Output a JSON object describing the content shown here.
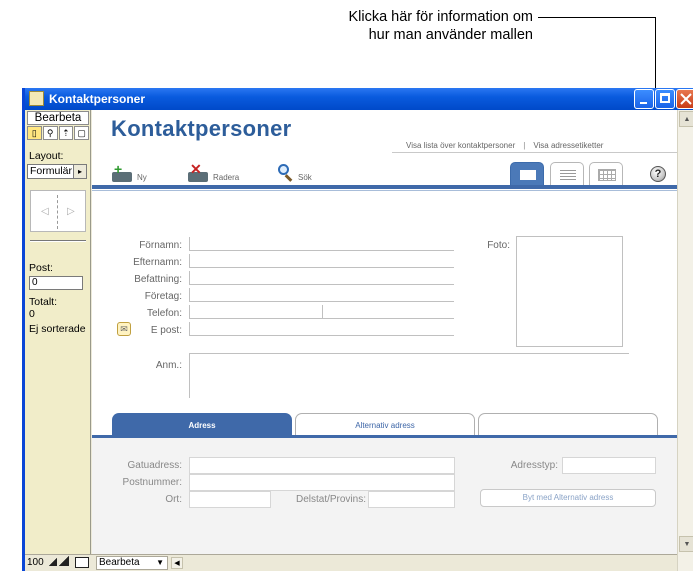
{
  "callout": {
    "line1": "Klicka här för information om",
    "line2": "hur man använder mallen"
  },
  "window": {
    "title": "Kontaktpersoner"
  },
  "toolbox": {
    "mode": "Bearbeta",
    "layout_label": "Layout:",
    "layout_value": "Formulär",
    "post_label": "Post:",
    "post_value": "0",
    "total_label": "Totalt:",
    "total_value": "0",
    "sort_status": "Ej sorterade"
  },
  "content": {
    "heading": "Kontaktpersoner",
    "link_list": "Visa lista över kontaktpersoner",
    "link_labels": "Visa adressetiketter",
    "link_sep": "|",
    "actions": {
      "new": "Ny",
      "delete": "Radera",
      "search": "Sök"
    },
    "help_glyph": "?"
  },
  "form": {
    "first_name": "Förnamn:",
    "last_name": "Efternamn:",
    "title": "Befattning:",
    "company": "Företag:",
    "phone": "Telefon:",
    "email": "E post:",
    "photo": "Foto:",
    "notes": "Anm.:"
  },
  "address": {
    "tabs": [
      "Adress",
      "Alternativ adress",
      ""
    ],
    "street": "Gatuadress:",
    "postal": "Postnummer:",
    "city": "Ort:",
    "state": "Delstat/Provins:",
    "type": "Adresstyp:",
    "swap_button": "Byt med Alternativ adress"
  },
  "statusbar": {
    "zoom": "100",
    "mode": "Bearbeta"
  }
}
